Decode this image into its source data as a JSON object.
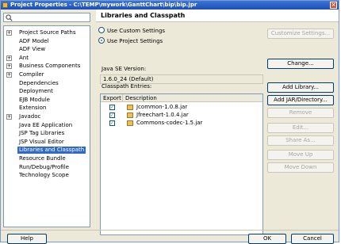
{
  "window": {
    "title": "Project Properties - C:\\TEMP\\mywork\\GanttChart\\bip\\bip.jpr"
  },
  "tree": {
    "items": [
      {
        "label": "Project Source Paths",
        "expander": "+"
      },
      {
        "label": "ADF Model",
        "expander": ""
      },
      {
        "label": "ADF View",
        "expander": ""
      },
      {
        "label": "Ant",
        "expander": "+"
      },
      {
        "label": "Business Components",
        "expander": "+"
      },
      {
        "label": "Compiler",
        "expander": "+"
      },
      {
        "label": "Dependencies",
        "expander": ""
      },
      {
        "label": "Deployment",
        "expander": ""
      },
      {
        "label": "EJB Module",
        "expander": ""
      },
      {
        "label": "Extension",
        "expander": ""
      },
      {
        "label": "Javadoc",
        "expander": "+"
      },
      {
        "label": "Java EE Application",
        "expander": ""
      },
      {
        "label": "JSP Tag Libraries",
        "expander": ""
      },
      {
        "label": "JSP Visual Editor",
        "expander": ""
      },
      {
        "label": "Libraries and Classpath",
        "expander": "",
        "selected": true
      },
      {
        "label": "Resource Bundle",
        "expander": ""
      },
      {
        "label": "Run/Debug/Profile",
        "expander": ""
      },
      {
        "label": "Technology Scope",
        "expander": ""
      }
    ]
  },
  "panel": {
    "title": "Libraries and Classpath",
    "radio_custom": "Use Custom Settings",
    "radio_project": "Use Project Settings",
    "customize_button": "Customize Settings...",
    "java_se_label": "Java SE Version:",
    "java_se_value": "1.6.0_24 (Default)",
    "change_button": "Change...",
    "classpath_label": "Classpath Entries:",
    "col_export": "Export",
    "col_description": "Description",
    "entries": [
      {
        "name": "Jcommon-1.0.8.jar",
        "export": true
      },
      {
        "name": "Jfreechart-1.0.4.jar",
        "export": true
      },
      {
        "name": "Commons-codec-1.5.jar",
        "export": true
      }
    ],
    "buttons": {
      "add_library": "Add Library...",
      "add_jar": "Add JAR/Directory...",
      "remove": "Remove",
      "edit": "Edit...",
      "share_as": "Share As...",
      "move_up": "Move Up",
      "move_down": "Move Down"
    }
  },
  "footer": {
    "help": "Help",
    "ok": "OK",
    "cancel": "Cancel"
  }
}
